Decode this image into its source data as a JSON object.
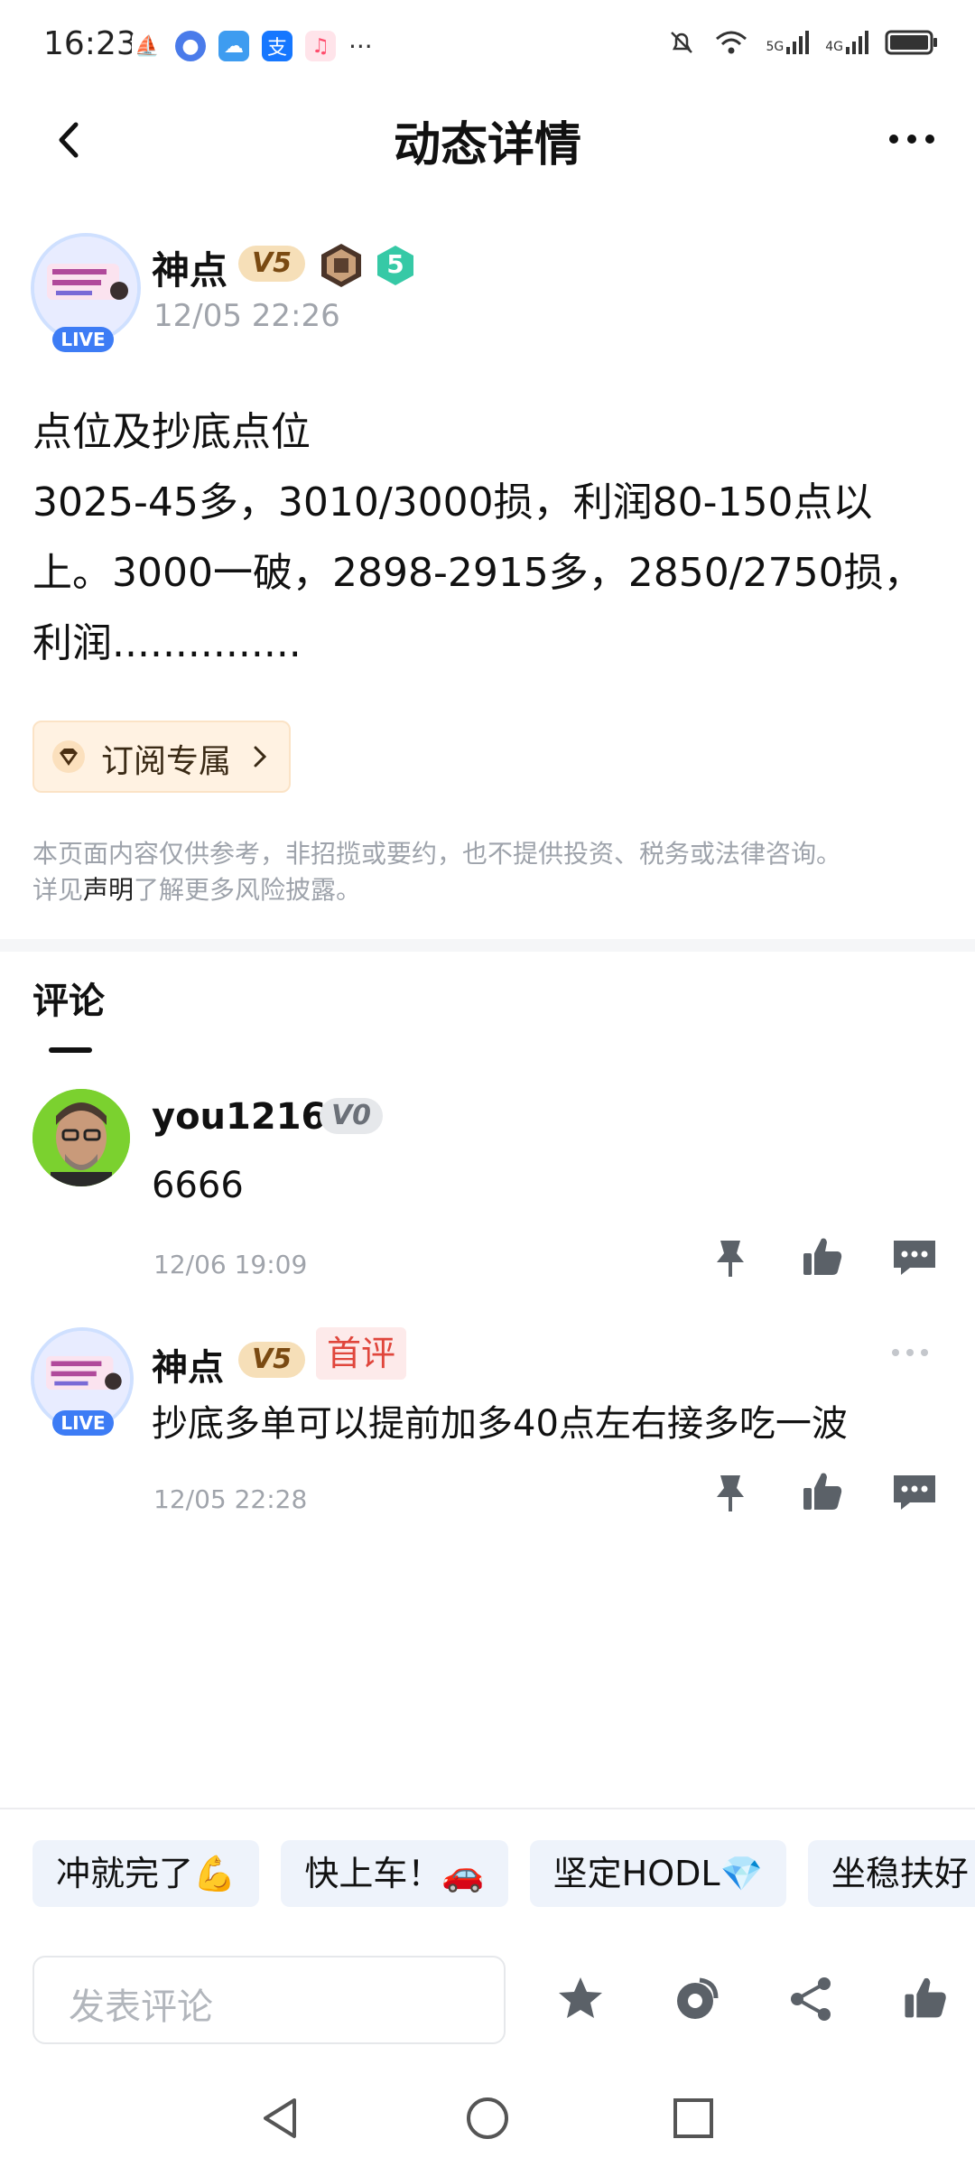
{
  "status_bar": {
    "time": "16:23",
    "overflow": "···",
    "network_5g": "5G",
    "network_4g": "4G"
  },
  "header": {
    "title": "动态详情"
  },
  "post": {
    "author_name": "神点",
    "vip_level": "V5",
    "level_badge": "5",
    "time": "12/05 22:26",
    "live_label": "LIVE",
    "content_line1": "点位及抄底点位",
    "content_rest": "3025-45多，3010/3000损，利润80-150点以上。3000一破，2898-2915多，2850/2750损，利润...............",
    "subscribe_label": "订阅专属"
  },
  "disclaimer": {
    "line1": "本页面内容仅供参考，非招揽或要约，也不提供投资、税务或法律咨询。",
    "prefix": "详见",
    "link": "声明",
    "suffix": "了解更多风险披露。"
  },
  "comments": {
    "title": "评论",
    "items": [
      {
        "name": "you1216",
        "vip_level": "V0",
        "text": "6666",
        "time": "12/06 19:09"
      },
      {
        "name": "神点",
        "vip_level": "V5",
        "badge": "首评",
        "live_label": "LIVE",
        "text": "抄底多单可以提前加多40点左右接多吃一波",
        "time": "12/05 22:28"
      }
    ]
  },
  "quick_replies": [
    "冲就完了💪",
    "快上车！🚗",
    "坚定HODL💎",
    "坐稳扶好"
  ],
  "input": {
    "placeholder": "发表评论"
  },
  "colors": {
    "accent_blue": "#3d7cf5",
    "vip_gold": "#f6dfb8",
    "first_badge_red": "#e0463c",
    "icon_gray": "#5b6168"
  }
}
